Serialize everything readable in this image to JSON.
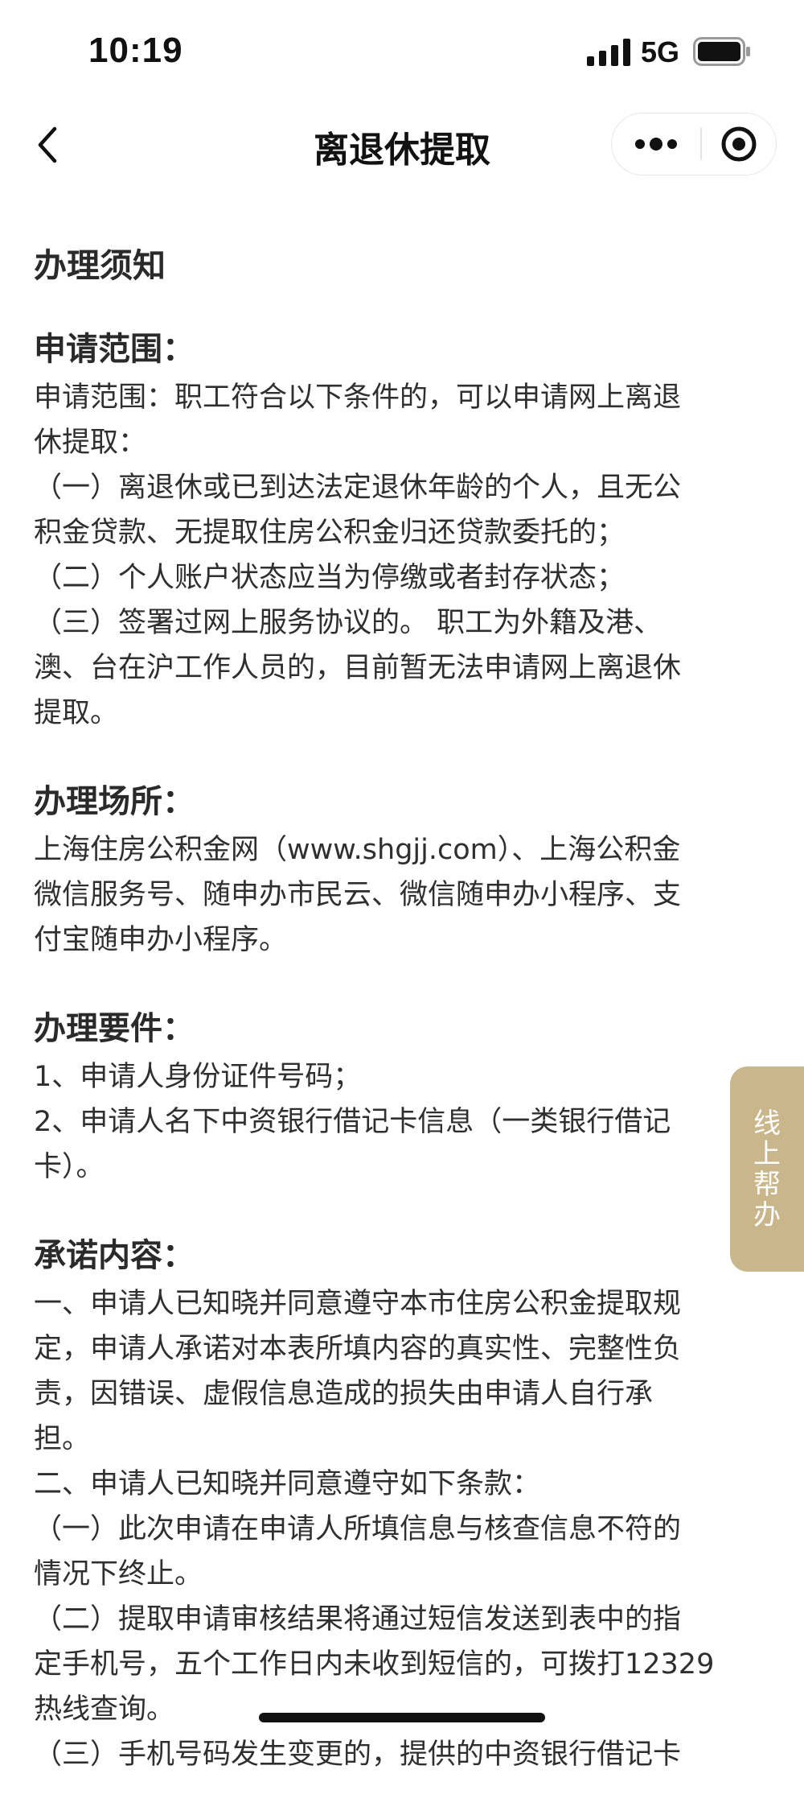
{
  "status_bar": {
    "time": "10:19",
    "network": "5G",
    "icons": [
      "signal-icon",
      "battery-icon"
    ]
  },
  "nav": {
    "title": "离退休提取",
    "icons": [
      "back-chevron-icon",
      "more-dots-icon",
      "close-target-icon"
    ]
  },
  "content": {
    "heading": "办理须知",
    "sections": [
      {
        "title": "申请范围：",
        "lines": [
          "申请范围：职工符合以下条件的，可以申请网上离退",
          "休提取：",
          "（一）离退休或已到达法定退休年龄的个人，且无公",
          "积金贷款、无提取住房公积金归还贷款委托的；",
          "（二）个人账户状态应当为停缴或者封存状态；",
          "（三）签署过网上服务协议的。 职工为外籍及港、",
          "澳、台在沪工作人员的，目前暂无法申请网上离退休",
          "提取。"
        ]
      },
      {
        "title": "办理场所：",
        "lines": [
          "上海住房公积金网（www.shgjj.com）、上海公积金",
          "微信服务号、随申办市民云、微信随申办小程序、支",
          "付宝随申办小程序。"
        ]
      },
      {
        "title": "办理要件：",
        "lines": [
          "1、申请人身份证件号码；",
          "2、申请人名下中资银行借记卡信息（一类银行借记",
          "卡）。"
        ]
      },
      {
        "title": "承诺内容：",
        "lines": [
          "一、申请人已知晓并同意遵守本市住房公积金提取规",
          "定，申请人承诺对本表所填内容的真实性、完整性负",
          "责，因错误、虚假信息造成的损失由申请人自行承",
          "担。",
          "二、申请人已知晓并同意遵守如下条款：",
          "（一）此次申请在申请人所填信息与核查信息不符的",
          "情况下终止。",
          "（二）提取申请审核结果将通过短信发送到表中的指",
          "定手机号，五个工作日内未收到短信的，可拨打12329",
          "热线查询。",
          "（三）手机号码发生变更的，提供的中资银行借记卡"
        ]
      }
    ]
  },
  "help_tab": {
    "label": "线上帮办",
    "color": "#c9b68a"
  }
}
